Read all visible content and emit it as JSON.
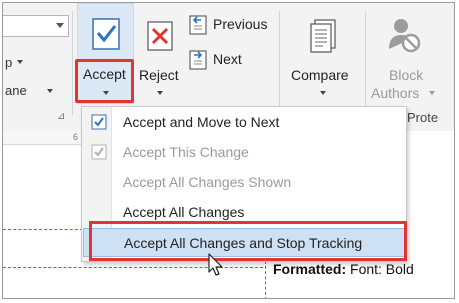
{
  "ribbon": {
    "left_group": {
      "line1_label": "p",
      "line2_label": "ane"
    },
    "buttons": {
      "accept": "Accept",
      "reject": "Reject",
      "previous": "Previous",
      "next": "Next",
      "compare": "Compare",
      "block_authors_line1": "Block",
      "block_authors_line2": "Authors"
    },
    "group_labels": {
      "protect": "Prote"
    },
    "ruler_mark": "6"
  },
  "accept_menu": {
    "items": [
      {
        "label": "Accept and Move to Next",
        "enabled": true,
        "icon": "check-doc-icon"
      },
      {
        "label": "Accept This Change",
        "enabled": false,
        "icon": "check-doc-icon"
      },
      {
        "label": "Accept All Changes Shown",
        "enabled": false,
        "icon": ""
      },
      {
        "label": "Accept All Changes",
        "enabled": true,
        "icon": ""
      },
      {
        "label": "Accept All Changes and Stop Tracking",
        "enabled": true,
        "icon": "",
        "highlighted": true
      }
    ]
  },
  "document": {
    "comment_bold": "Formatted:",
    "comment_text": " Font: Bold"
  },
  "colors": {
    "highlight_outline": "#e2352f",
    "hover_fill": "#cde0f4",
    "accept_button_fill": "#dbe9f7",
    "track_change_line": "#d0443e"
  }
}
